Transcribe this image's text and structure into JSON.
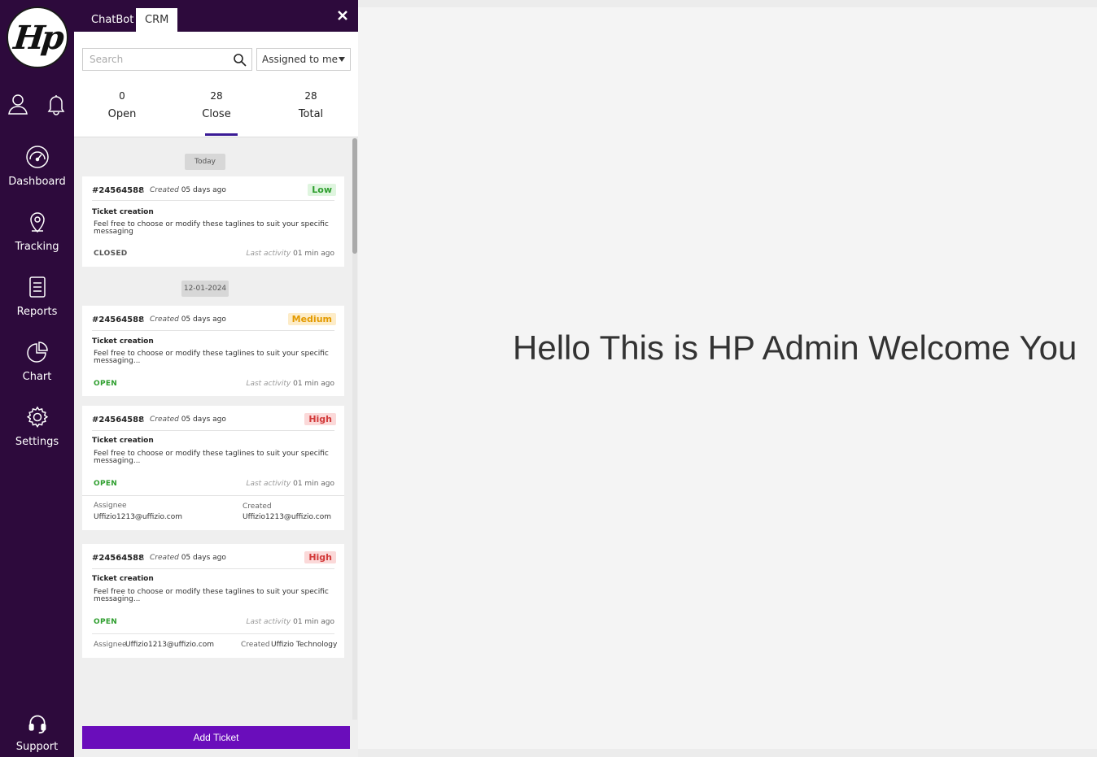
{
  "logo": {
    "text": "Hp"
  },
  "sidebar": {
    "items": [
      {
        "label": "Dashboard"
      },
      {
        "label": "Tracking"
      },
      {
        "label": "Reports"
      },
      {
        "label": "Chart"
      },
      {
        "label": "Settings"
      }
    ],
    "support_label": "Support"
  },
  "panel": {
    "tabs": [
      {
        "label": "ChatBot"
      },
      {
        "label": "CRM"
      }
    ],
    "search_placeholder": "Search",
    "filter_selected": "Assigned to me",
    "stats": [
      {
        "value": "0",
        "label": "Open"
      },
      {
        "value": "28",
        "label": "Close"
      },
      {
        "value": "28",
        "label": "Total"
      }
    ],
    "date_groups": [
      "Today",
      "12-01-2024"
    ],
    "tickets": [
      {
        "id": "#24564588",
        "created_label": "Created",
        "created_value": "05 days ago",
        "priority": "Low",
        "title": "Ticket creation",
        "desc_line1": "Feel free to choose or modify these taglines to suit your specific",
        "desc_line2": "messaging",
        "status": "CLOSED",
        "last_label": "Last activity",
        "last_value": "01 min ago"
      },
      {
        "id": "#24564588",
        "created_label": "Created",
        "created_value": "05 days ago",
        "priority": "Medium",
        "title": "Ticket creation",
        "desc_line1": "Feel free to choose or modify these taglines to suit your specific",
        "desc_line2": "messaging...",
        "status": "OPEN",
        "last_label": "Last activity",
        "last_value": "01 min ago"
      },
      {
        "id": "#24564588",
        "created_label": "Created",
        "created_value": "05 days ago",
        "priority": "High",
        "title": "Ticket creation",
        "desc_line1": "Feel free to choose or modify these taglines to suit your specific",
        "desc_line2": "messaging...",
        "status": "OPEN",
        "last_label": "Last activity",
        "last_value": "01 min ago",
        "assignee_label": "Assignee",
        "assignee_value": "Uffizio1213@uffizio.com",
        "createdby_label": "Created",
        "createdby_value": "Uffizio1213@uffizio.com"
      },
      {
        "id": "#24564588",
        "created_label": "Created",
        "created_value": "05 days ago",
        "priority": "High",
        "title": "Ticket creation",
        "desc_line1": "Feel free to choose or modify these taglines to suit your specific",
        "desc_line2": "messaging...",
        "status": "OPEN",
        "last_label": "Last activity",
        "last_value": "01 min ago",
        "assignee_label": "Assignee",
        "assignee_value": "Uffizio1213@uffizio.com",
        "createdby_label": "Created",
        "createdby_value": "Uffizio Technology"
      }
    ],
    "add_ticket_label": "Add Ticket"
  },
  "main": {
    "welcome_text": "Hello This is HP Admin Welcome You"
  },
  "colors": {
    "sidebar_bg": "#2d0a3c",
    "accent": "#6a0dbb",
    "active_tab_underline": "#3b1b96",
    "status_open": "#2e9e2e",
    "priority_low": "#2e9e2e",
    "priority_medium": "#e39a00",
    "priority_high": "#d23a3a"
  }
}
